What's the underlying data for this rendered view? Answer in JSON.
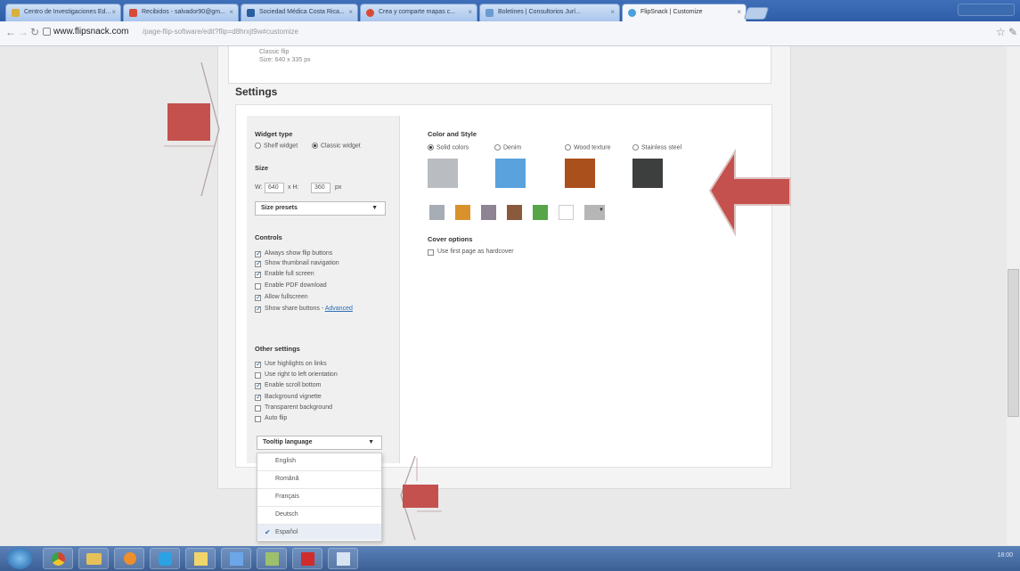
{
  "browser": {
    "tabs": [
      {
        "label": "Centro de Investigaciones Ed..."
      },
      {
        "label": "Recibidos - salvador90@gm..."
      },
      {
        "label": "Sociedad Médica Costa Rica..."
      },
      {
        "label": "Crea y comparte mapas c..."
      },
      {
        "label": "Boletines | Consultorios Jurí..."
      },
      {
        "label": "FlipSnack | Customize"
      }
    ],
    "url_host": "www.flipsnack.com",
    "url_path": "/page-flip-software/edit?flip=d8hrxjt9w#customize"
  },
  "top_card": {
    "line1": "Classic flip",
    "line2": "Size: 640 x 335 px"
  },
  "settings": {
    "title": "Settings",
    "widget_type": {
      "heading": "Widget type",
      "options": [
        "Shelf widget",
        "Classic widget"
      ],
      "selected": "Classic widget"
    },
    "size": {
      "heading": "Size",
      "w_label": "W:",
      "w_value": "640",
      "h_label": "x H:",
      "h_value": "360",
      "unit": "px",
      "presets_label": "Size presets"
    },
    "controls": {
      "heading": "Controls",
      "items": [
        {
          "label": "Always show flip buttons",
          "checked": true
        },
        {
          "label": "Show thumbnail navigation",
          "checked": true
        },
        {
          "label": "Enable full screen",
          "checked": true
        },
        {
          "label": "Enable PDF download",
          "checked": false
        },
        {
          "label": "Allow fullscreen",
          "checked": true
        },
        {
          "label": "Show share buttons -",
          "checked": true,
          "link": "Advanced"
        }
      ]
    },
    "other": {
      "heading": "Other settings",
      "items": [
        {
          "label": "Use highlights on links",
          "checked": true
        },
        {
          "label": "Use right to left orientation",
          "checked": false
        },
        {
          "label": "Enable scroll bottom",
          "checked": true
        },
        {
          "label": "Background vignette",
          "checked": true
        },
        {
          "label": "Transparent background",
          "checked": false
        },
        {
          "label": "Auto flip",
          "checked": false
        }
      ]
    },
    "tooltip_language": {
      "label": "Tooltip language",
      "options": [
        "English",
        "Română",
        "Français",
        "Deutsch",
        "Español"
      ],
      "selected": "Español"
    },
    "color_style": {
      "heading": "Color and Style",
      "options": [
        "Solid colors",
        "Denim",
        "Wood texture",
        "Stainless steel"
      ],
      "selected": "Solid colors",
      "big_swatches": [
        "#b9bcc0",
        "#5aa2de",
        "#a9501c",
        "#3d3f3e"
      ],
      "small_swatches": [
        "#a7adb5",
        "#d9912c",
        "#8e8494",
        "#8a5a3c",
        "#57a549",
        "#ffffff",
        "#b6b6b6"
      ]
    },
    "cover_options": {
      "heading": "Cover options",
      "item": "Use first page as hardcover",
      "checked": false
    }
  },
  "taskbar": {
    "clock": "18:00"
  },
  "colors": {
    "annotation_arrow": "#c4514d",
    "annotation_arrow_edge": "#a93e3b"
  }
}
